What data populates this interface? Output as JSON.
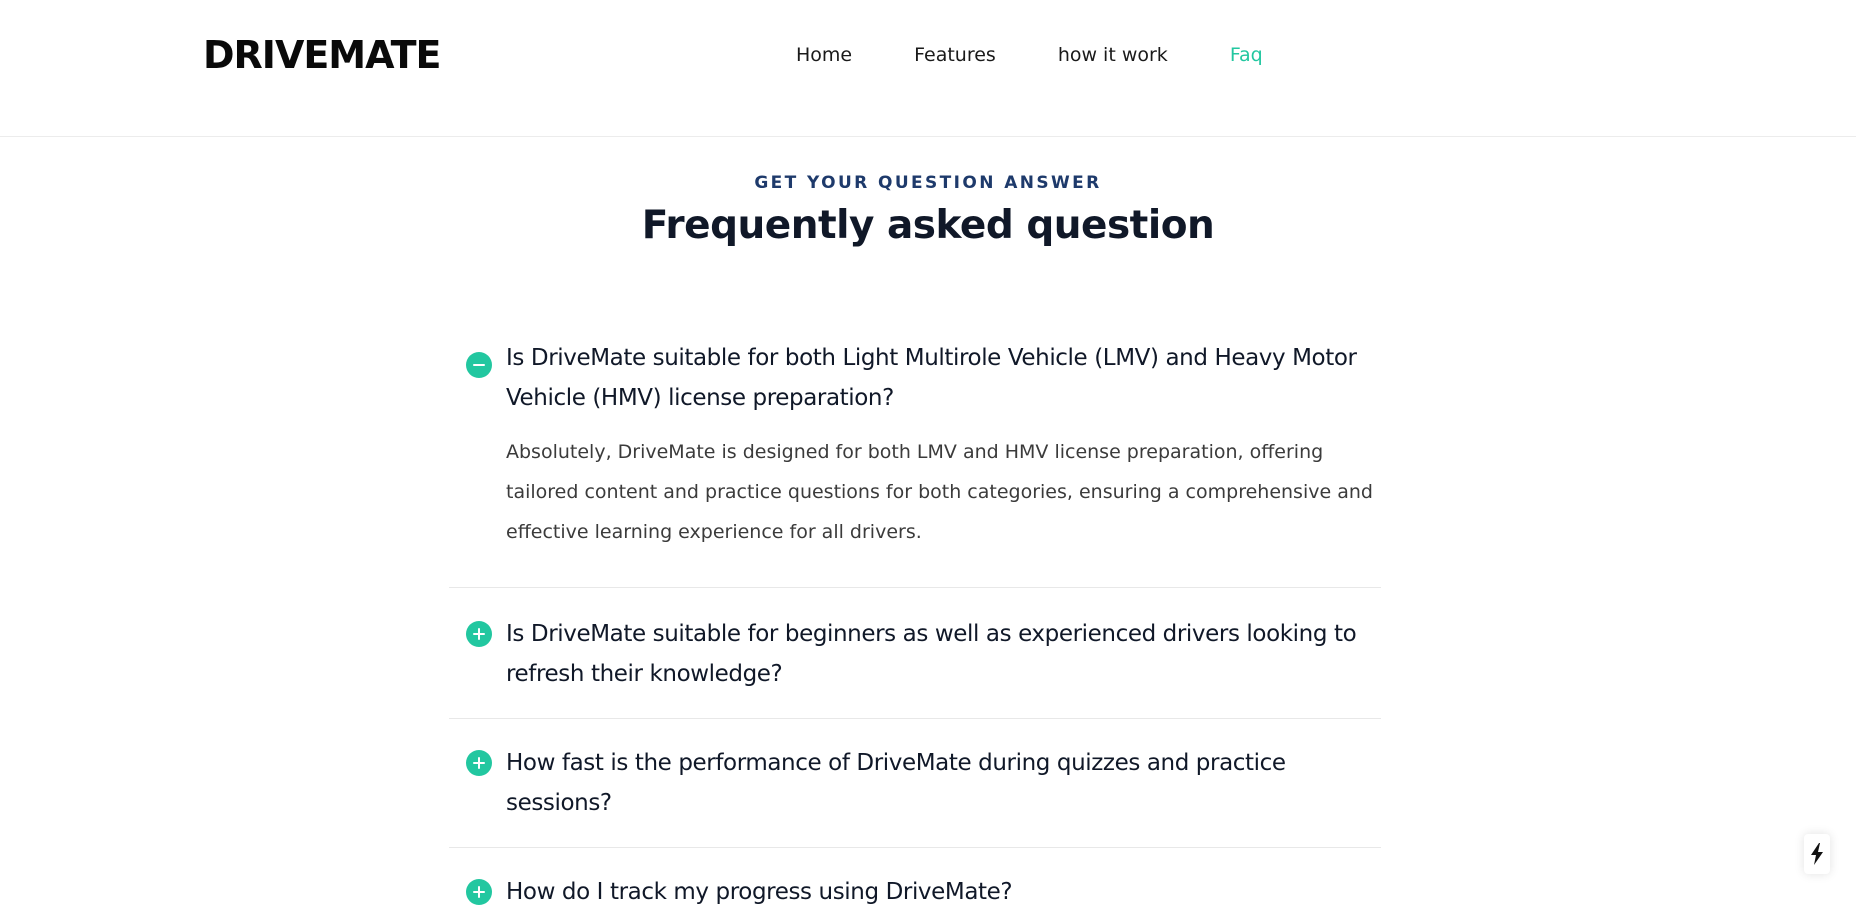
{
  "header": {
    "logo": "DRIVEMATE",
    "nav": [
      {
        "label": "Home"
      },
      {
        "label": "Features"
      },
      {
        "label": "how it work"
      },
      {
        "label": "Faq"
      }
    ]
  },
  "section": {
    "eyebrow": "GET YOUR QUESTION ANSWER",
    "title": "Frequently asked question"
  },
  "faq": [
    {
      "question": "Is DriveMate suitable for both Light Multirole Vehicle (LMV) and Heavy Motor Vehicle (HMV) license preparation?",
      "answer": "Absolutely, DriveMate is designed for both LMV and HMV license preparation, offering tailored content and practice questions for both categories, ensuring a comprehensive and effective learning experience for all drivers.",
      "expanded": true,
      "icon": "minus-circle-icon"
    },
    {
      "question": "Is DriveMate suitable for beginners as well as experienced drivers looking to refresh their knowledge?",
      "expanded": false,
      "icon": "plus-circle-icon"
    },
    {
      "question": "How fast is the performance of DriveMate during quizzes and practice sessions?",
      "expanded": false,
      "icon": "plus-circle-icon"
    },
    {
      "question": "How do I track my progress using DriveMate?",
      "expanded": false,
      "icon": "plus-circle-icon"
    }
  ],
  "colors": {
    "accent": "#22c7a0",
    "eyebrow": "#1e3a6b",
    "heading": "#101828"
  },
  "widget": {
    "icon": "lightning-bolt-icon"
  }
}
